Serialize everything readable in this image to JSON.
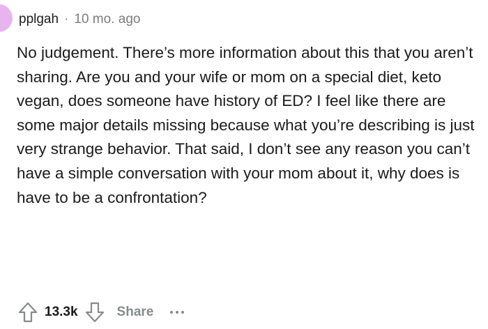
{
  "comment": {
    "author": "pplgah",
    "separator": "·",
    "time": "10 mo. ago",
    "body": "No judgement. There’s more information about this that you aren’t sharing. Are you and your wife or mom on a special diet, keto vegan, does someone have history of ED? I feel like there are some major details missing because what you’re describing is just very strange behavior. That said, I don’t see any reason you can’t have a simple conversation with your mom about it, why does is have to be a confrontation?"
  },
  "actions": {
    "upvote_icon": "arrow-up-icon",
    "vote_count": "13.3k",
    "downvote_icon": "arrow-down-icon",
    "share_label": "Share",
    "more_icon": "more-dots-icon"
  },
  "colors": {
    "avatar": "#e7b4f0",
    "muted_text": "#7c7c7c",
    "icon_gray": "#878a8c",
    "body_text": "#1a1a1b"
  }
}
